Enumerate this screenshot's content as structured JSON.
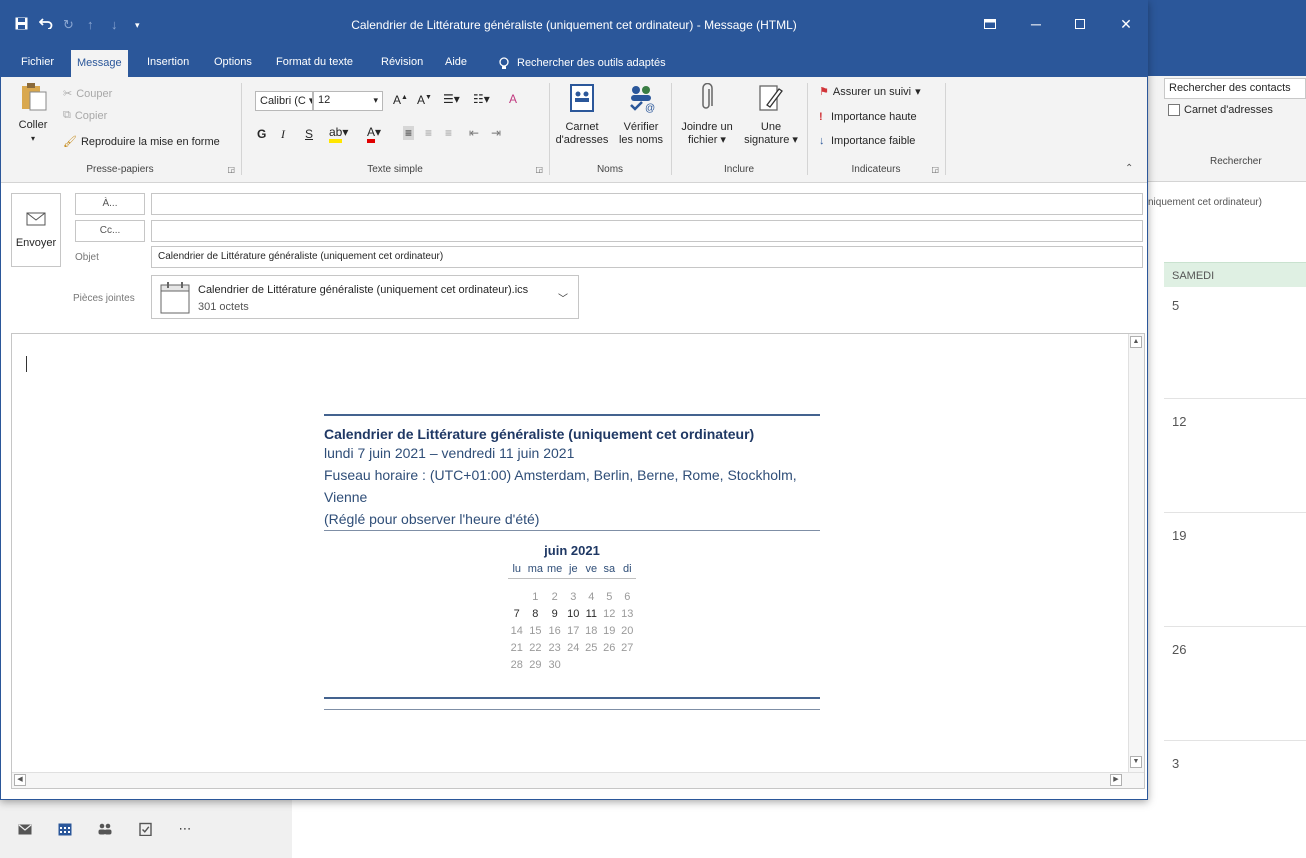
{
  "window": {
    "title": "Calendrier de Littérature généraliste (uniquement cet ordinateur)  -  Message (HTML)"
  },
  "tabs": {
    "fichier": "Fichier",
    "message": "Message",
    "insertion": "Insertion",
    "options": "Options",
    "format": "Format du texte",
    "revision": "Révision",
    "aide": "Aide",
    "search": "Rechercher des outils adaptés"
  },
  "ribbon": {
    "clipboard": {
      "paste": "Coller",
      "cut": "Couper",
      "copy": "Copier",
      "format_painter": "Reproduire la mise en forme",
      "label": "Presse-papiers"
    },
    "text": {
      "font": "Calibri (C",
      "size": "12",
      "label": "Texte simple"
    },
    "names": {
      "address_book_1": "Carnet",
      "address_book_2": "d'adresses",
      "check_names_1": "Vérifier",
      "check_names_2": "les noms",
      "label": "Noms"
    },
    "include": {
      "attach_1": "Joindre un",
      "attach_2": "fichier",
      "signature_1": "Une",
      "signature_2": "signature",
      "label": "Inclure"
    },
    "tags": {
      "follow_up": "Assurer un suivi",
      "high": "Importance haute",
      "low": "Importance faible",
      "label": "Indicateurs"
    }
  },
  "compose": {
    "send": "Envoyer",
    "to_btn": "À...",
    "cc_btn": "Cc...",
    "subject_label": "Objet",
    "subject": "Calendrier de Littérature généraliste (uniquement cet ordinateur)",
    "attachments_label": "Pièces jointes",
    "attachment_name": "Calendrier de Littérature généraliste (uniquement cet ordinateur).ics",
    "attachment_size": "301 octets"
  },
  "calendar_body": {
    "title": "Calendrier de Littérature généraliste (uniquement cet ordinateur)",
    "range": "lundi 7 juin 2021 – vendredi 11 juin 2021",
    "tz_line1": "Fuseau horaire : (UTC+01:00) Amsterdam, Berlin, Berne, Rome, Stockholm,",
    "tz_line2": "Vienne",
    "dst": "(Réglé pour observer l'heure d'été)",
    "month": "juin 2021",
    "weekdays": [
      "lu",
      "ma",
      "me",
      "je",
      "ve",
      "sa",
      "di"
    ],
    "weeks": [
      [
        "",
        "1",
        "2",
        "3",
        "4",
        "5",
        "6"
      ],
      [
        "7",
        "8",
        "9",
        "10",
        "11",
        "12",
        "13"
      ],
      [
        "14",
        "15",
        "16",
        "17",
        "18",
        "19",
        "20"
      ],
      [
        "21",
        "22",
        "23",
        "24",
        "25",
        "26",
        "27"
      ],
      [
        "28",
        "29",
        "30",
        "",
        "",
        "",
        ""
      ]
    ],
    "highlight_week": 1
  },
  "background": {
    "search_contacts": "Rechercher des contacts",
    "address_book": "Carnet d'adresses",
    "search_group": "Rechercher",
    "folder_fragment": "niquement cet ordinateur)",
    "day_header": "SAMEDI",
    "dates": [
      "5",
      "12",
      "19",
      "26",
      "3"
    ]
  },
  "colors": {
    "accent": "#2b579a",
    "calendar_title": "#1f3864",
    "day_header_bg": "#dff0e3"
  }
}
